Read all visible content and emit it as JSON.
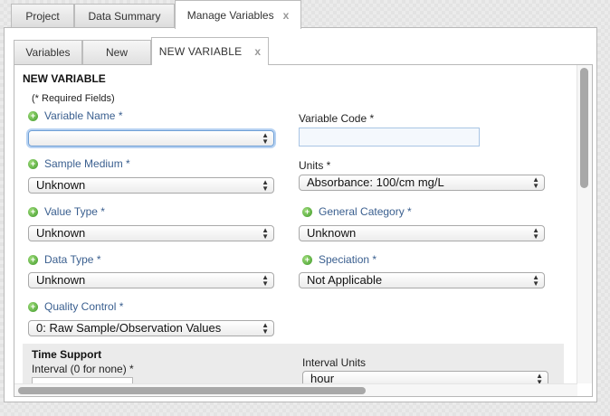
{
  "top_tabs": [
    {
      "label": "Project"
    },
    {
      "label": "Data Summary"
    },
    {
      "label": "Manage Variables",
      "close": "x"
    }
  ],
  "inner_tabs": [
    {
      "label": "Variables"
    },
    {
      "label": "New"
    },
    {
      "label": "NEW VARIABLE",
      "close": "x"
    }
  ],
  "form": {
    "title": "NEW VARIABLE",
    "required_note": "(* Required Fields)",
    "variable_name": {
      "label": "Variable Name *",
      "value": ""
    },
    "variable_code": {
      "label": "Variable Code *",
      "value": ""
    },
    "sample_medium": {
      "label": "Sample Medium *",
      "value": "Unknown"
    },
    "units": {
      "label": "Units *",
      "value": "Absorbance: 100/cm mg/L"
    },
    "value_type": {
      "label": "Value Type *",
      "value": "Unknown"
    },
    "general_category": {
      "label": "General Category *",
      "value": "Unknown"
    },
    "data_type": {
      "label": "Data Type *",
      "value": "Unknown"
    },
    "speciation": {
      "label": "Speciation *",
      "value": "Not Applicable"
    },
    "quality_control": {
      "label": "Quality Control *",
      "value": "0: Raw Sample/Observation Values"
    }
  },
  "time_support": {
    "title": "Time Support",
    "interval_label": "Interval (0 for none) *",
    "interval_units_label": "Interval Units",
    "interval_units_value": "hour"
  },
  "icons": {
    "add": "plus-circle-icon",
    "select_arrows": "updown-arrows-icon"
  },
  "colors": {
    "field_label": "#3a5f8f",
    "add_icon": "#3f9a2a",
    "focus": "#6e9fd6"
  }
}
